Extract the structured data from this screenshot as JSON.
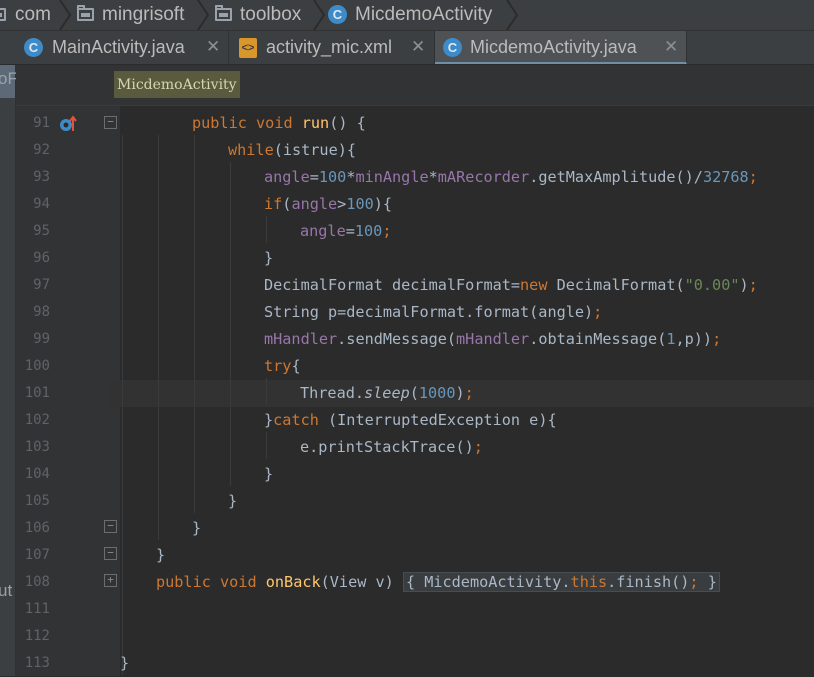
{
  "breadcrumbs": [
    {
      "label": "com",
      "icon": "folder-icon"
    },
    {
      "label": "mingrisoft",
      "icon": "folder-icon"
    },
    {
      "label": "toolbox",
      "icon": "folder-icon"
    },
    {
      "label": "MicdemoActivity",
      "icon": "class-icon"
    }
  ],
  "tabs": [
    {
      "label": "MainActivity.java",
      "icon": "class-icon",
      "active": false
    },
    {
      "label": "activity_mic.xml",
      "icon": "xml-icon",
      "active": false
    },
    {
      "label": "MicdemoActivity.java",
      "icon": "class-icon",
      "active": true
    }
  ],
  "tab_close_glyph": "✕",
  "class_icon_letter": "C",
  "method_breadcrumb": "MicdemoActivity",
  "left_strip_texts": {
    "top": "oF",
    "bottom": "ut"
  },
  "line_numbers": [
    "91",
    "92",
    "93",
    "94",
    "95",
    "96",
    "97",
    "98",
    "99",
    "100",
    "101",
    "102",
    "103",
    "104",
    "105",
    "106",
    "107",
    "108",
    "111",
    "112",
    "113"
  ],
  "code": {
    "l91": {
      "kw1": "public",
      "kw2": "void",
      "name": "run",
      "rest": "() {"
    },
    "l92": {
      "kw": "while",
      "rest": "(istrue){"
    },
    "l93": {
      "f1": "angle",
      "op1": "=",
      "n1": "100",
      "op2": "*",
      "f2": "minAngle",
      "op3": "*",
      "f3": "mARecorder",
      "call": ".getMaxAmplitude()/",
      "n2": "32768",
      "semi": ";"
    },
    "l94": {
      "kw": "if",
      "p1": "(",
      "f1": "angle",
      "op": ">",
      "n1": "100",
      "rest": "){"
    },
    "l95": {
      "f1": "angle",
      "op": "=",
      "n1": "100",
      "semi": ";"
    },
    "l96": {
      "text": "}"
    },
    "l97": {
      "t1": "DecimalFormat decimalFormat=",
      "kw": "new",
      "t2": " DecimalFormat(",
      "s": "\"0.00\"",
      "t3": ")",
      "semi": ";"
    },
    "l98": {
      "t1": "String p=decimalFormat.format(angle)",
      "semi": ";"
    },
    "l99": {
      "f1": "mHandler",
      "t1": ".sendMessage(",
      "f2": "mHandler",
      "t2": ".obtainMessage(",
      "n1": "1",
      "t3": ",p))",
      "semi": ";"
    },
    "l100": {
      "kw": "try",
      "rest": "{"
    },
    "l101": {
      "t1": "Thread.",
      "m": "sleep",
      "t2": "(",
      "n1": "1000",
      "t3": ")",
      "semi": ";"
    },
    "l102": {
      "t1": "}",
      "kw": "catch",
      "t2": " (InterruptedException e){"
    },
    "l103": {
      "t1": "e.printStackTrace()",
      "semi": ";"
    },
    "l104": {
      "text": "}"
    },
    "l105": {
      "text": "}"
    },
    "l106": {
      "text": "}"
    },
    "l107": {
      "text": "}"
    },
    "l108": {
      "kw1": "public",
      "kw2": "void",
      "name": "onBack",
      "t1": "(View v) ",
      "chip_open": "{",
      "t2": " MicdemoActivity.",
      "kw3": "this",
      "t3": ".finish()",
      "semi": ";",
      "chip_close": "}"
    },
    "l113": {
      "text": "}"
    }
  },
  "colors": {
    "editor_bg": "#2b2b2b",
    "keyword": "#cc7832",
    "field": "#9876aa",
    "number": "#6897bb",
    "string": "#6a8759",
    "text": "#a9b7c6",
    "line_number": "#606366"
  }
}
